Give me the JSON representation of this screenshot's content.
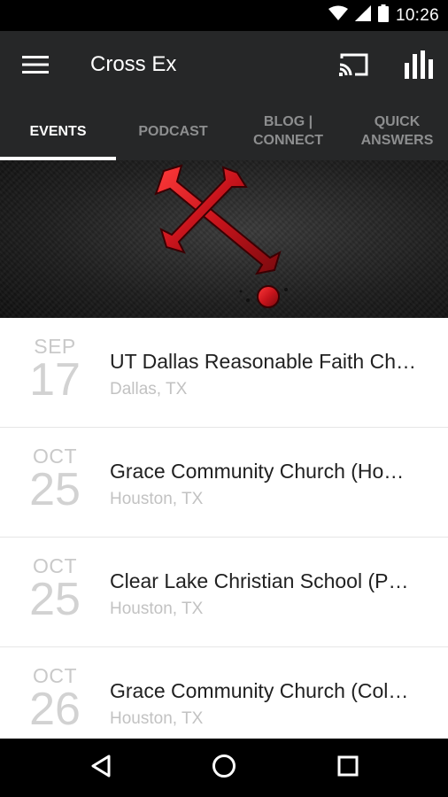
{
  "status_bar": {
    "time": "10:26",
    "icons": [
      "wifi-icon",
      "signal-icon",
      "battery-icon"
    ]
  },
  "app_bar": {
    "title": "Cross Ex",
    "icons": [
      "menu-icon",
      "cast-icon",
      "stats-icon"
    ]
  },
  "tabs": [
    {
      "label": "EVENTS",
      "active": true
    },
    {
      "label": "PODCAST",
      "active": false
    },
    {
      "label": "BLOG |\nCONNECT",
      "active": false
    },
    {
      "label": "QUICK\nANSWERS",
      "active": false
    }
  ],
  "events": [
    {
      "month": "SEP",
      "day": "17",
      "title": "UT Dallas Reasonable Faith Ch…",
      "location": "Dallas, TX"
    },
    {
      "month": "OCT",
      "day": "25",
      "title": "Grace Community Church (Ho…",
      "location": "Houston, TX"
    },
    {
      "month": "OCT",
      "day": "25",
      "title": "Clear Lake Christian School (P…",
      "location": "Houston, TX"
    },
    {
      "month": "OCT",
      "day": "26",
      "title": "Grace Community Church (Col…",
      "location": "Houston, TX"
    }
  ],
  "nav_bar": {
    "icons": [
      "back-icon",
      "home-icon",
      "recents-icon"
    ]
  },
  "colors": {
    "app_bar": "#262728",
    "status_bar": "#000000",
    "cross_red": "#c8141c",
    "tab_active": "#ffffff",
    "tab_inactive": "#8d8e8f"
  }
}
